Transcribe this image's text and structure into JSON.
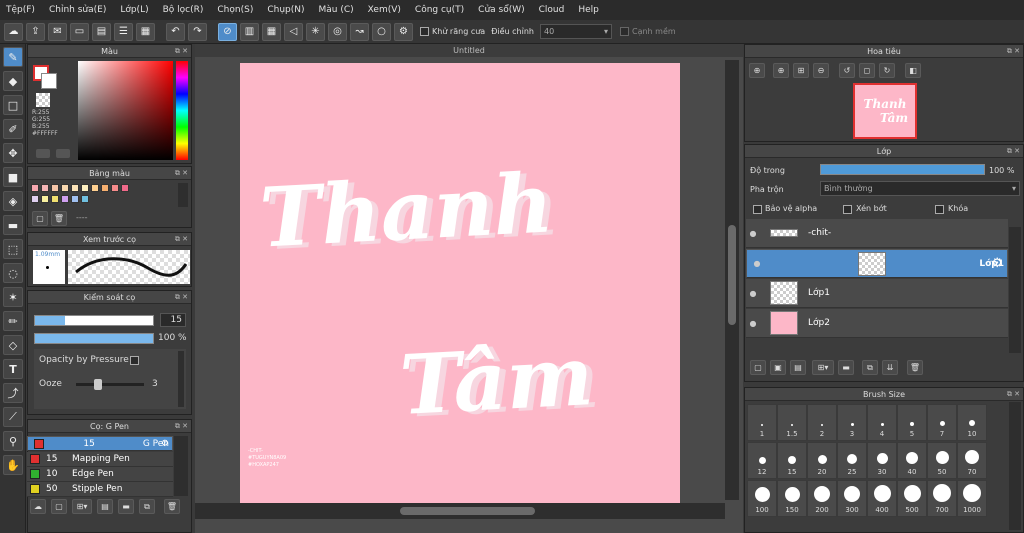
{
  "menu": [
    "Tệp(F)",
    "Chỉnh sửa(E)",
    "Lớp(L)",
    "Bộ lọc(R)",
    "Chọn(S)",
    "Chụp(N)",
    "Màu (C)",
    "Xem(V)",
    "Công cụ(T)",
    "Cửa sổ(W)",
    "Cloud",
    "Help"
  ],
  "toolbar": {
    "antialias_label": "Khử răng cưa",
    "adjust_label": "Điều chỉnh",
    "adjust_value": "40",
    "soft_edge_label": "Cạnh mềm"
  },
  "color_panel": {
    "title": "Màu",
    "r": "R:255",
    "g": "G:255",
    "b": "B:255",
    "hex": "#FFFFFF"
  },
  "palette_panel": {
    "title": "Bảng màu",
    "extra": "----"
  },
  "preview_panel": {
    "title": "Xem trước cọ",
    "size": "1.09mm"
  },
  "brush_control": {
    "title": "Kiểm soát cọ",
    "size_value": "15",
    "opacity_value": "100 %",
    "opacity_pressure_label": "Opacity by Pressure",
    "ooze_label": "Ooze",
    "ooze_value": "3",
    "size_fill": 0.25,
    "opacity_fill": 1.0,
    "ooze_fill": 0.3
  },
  "brush_panel": {
    "title": "Cọ: G Pen",
    "brushes": [
      {
        "size": "15",
        "name": "G Pen",
        "color": "#e03030"
      },
      {
        "size": "15",
        "name": "Mapping Pen",
        "color": "#e03030"
      },
      {
        "size": "10",
        "name": "Edge Pen",
        "color": "#30b030"
      },
      {
        "size": "50",
        "name": "Stipple Pen",
        "color": "#e0d020"
      }
    ]
  },
  "document": {
    "title": "Untitled",
    "art_line1": "Thanh",
    "art_line2": "Tâm",
    "signature_line1": "-CHIT-",
    "signature_line2": "#TUGUYN8A09",
    "signature_line3": "#HOXAP247"
  },
  "navigator": {
    "title": "Hoa tiêu"
  },
  "layer_panel": {
    "title": "Lớp",
    "opacity_label": "Độ trong",
    "opacity_value": "100 %",
    "opacity_fill": 1.0,
    "blend_label": "Pha trộn",
    "blend_value": "Bình thường",
    "protect_alpha_label": "Bảo vệ alpha",
    "clipping_label": "Xén bớt",
    "lock_label": "Khóa",
    "layers": [
      {
        "name": "-chit-"
      },
      {
        "name": "Lớp1"
      },
      {
        "name": "Lớp1"
      },
      {
        "name": "Lớp2"
      }
    ]
  },
  "brush_size_panel": {
    "title": "Brush Size",
    "sizes": [
      "1",
      "1.5",
      "2",
      "3",
      "4",
      "5",
      "7",
      "10",
      "12",
      "15",
      "20",
      "25",
      "30",
      "40",
      "50",
      "70",
      "100",
      "150",
      "200",
      "300",
      "400",
      "500",
      "700",
      "1000"
    ]
  },
  "colors": {
    "accent": "#4f8cc9",
    "canvas_pink": "#fdb7c8"
  }
}
